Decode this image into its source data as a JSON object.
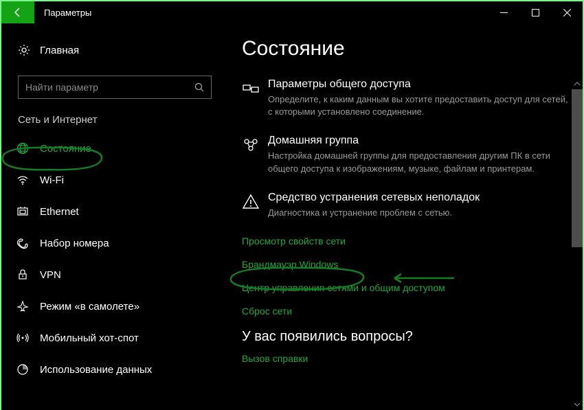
{
  "window": {
    "title": "Параметры"
  },
  "sidebar": {
    "home": "Главная",
    "search_placeholder": "Найти параметр",
    "section_header": "Сеть и Интернет",
    "items": [
      {
        "label": "Состояние",
        "icon": "globe-icon",
        "active": true
      },
      {
        "label": "Wi-Fi",
        "icon": "wifi-icon",
        "active": false
      },
      {
        "label": "Ethernet",
        "icon": "ethernet-icon",
        "active": false
      },
      {
        "label": "Набор номера",
        "icon": "dialup-icon",
        "active": false
      },
      {
        "label": "VPN",
        "icon": "vpn-icon",
        "active": false
      },
      {
        "label": "Режим «в самолете»",
        "icon": "airplane-icon",
        "active": false
      },
      {
        "label": "Мобильный хот-спот",
        "icon": "hotspot-icon",
        "active": false
      },
      {
        "label": "Использование данных",
        "icon": "data-usage-icon",
        "active": false
      }
    ]
  },
  "main": {
    "title": "Состояние",
    "blocks": [
      {
        "title": "Параметры общего доступа",
        "desc": "Определите, к каким данным вы хотите предоставить доступ для сетей, с которыми установлено соединение."
      },
      {
        "title": "Домашняя группа",
        "desc": "Настройка домашней группы для предоставления другим ПК в сети общего доступа к изображениям, музыке, файлам и принтерам."
      },
      {
        "title": "Средство устранения сетевых неполадок",
        "desc": "Диагностика и устранение проблем с сетью."
      }
    ],
    "links": [
      "Просмотр свойств сети",
      "Брандмауэр Windows",
      "Центр управления сетями и общим доступом",
      "Сброс сети"
    ],
    "questions_heading": "У вас появились вопросы?",
    "help_link": "Вызов справки"
  },
  "colors": {
    "accent": "#14a314",
    "link": "#1fa83a"
  }
}
